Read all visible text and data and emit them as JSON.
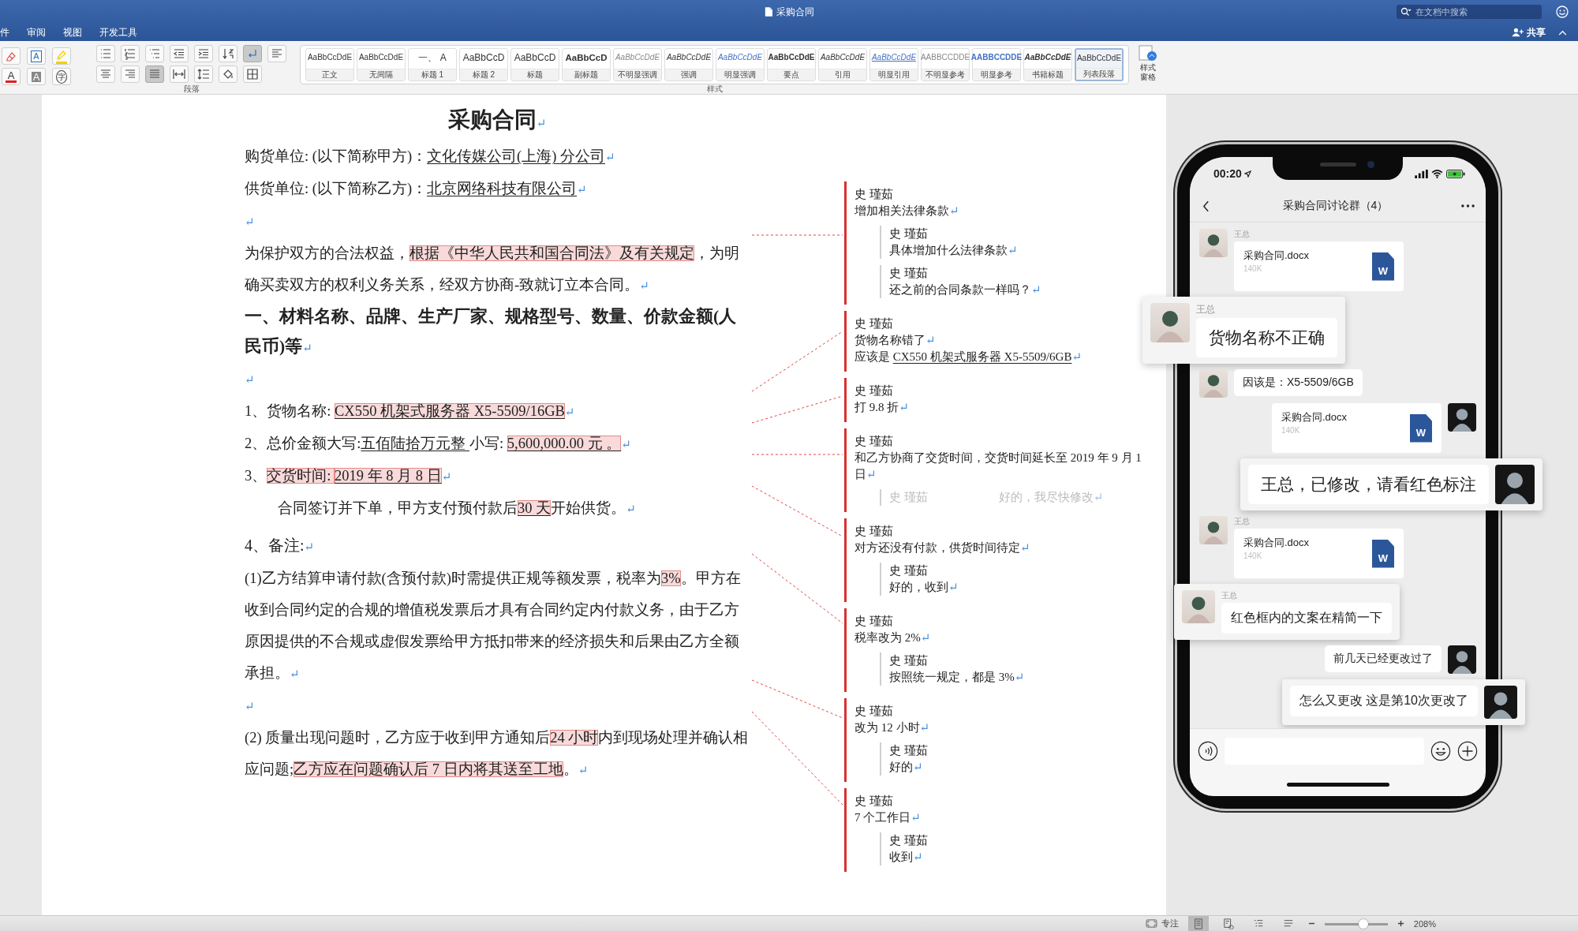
{
  "window": {
    "title": "采购合同",
    "search": {
      "placeholder": "在文档中搜索"
    },
    "share": "共享"
  },
  "ribbon": {
    "tabs": [
      {
        "label": "件"
      },
      {
        "label": "审阅"
      },
      {
        "label": "视图"
      },
      {
        "label": "开发工具"
      }
    ],
    "font_tools": [
      {
        "kind": "clear_format"
      },
      {
        "kind": "text_box",
        "glyph": "A"
      },
      {
        "kind": "highlight"
      },
      {
        "kind": "font_color",
        "glyph": "A"
      },
      {
        "kind": "char_shading",
        "glyph": "A"
      },
      {
        "kind": "enclosed",
        "glyph": "字"
      }
    ],
    "paragraph_tools": [
      {
        "kind": "bullets",
        "on": false
      },
      {
        "kind": "numbering",
        "on": false
      },
      {
        "kind": "multilevel",
        "on": false
      },
      {
        "kind": "outdent",
        "on": false
      },
      {
        "kind": "indent",
        "on": false
      },
      {
        "kind": "sort",
        "on": false
      },
      {
        "kind": "marks",
        "on": true
      },
      {
        "kind": "align_left",
        "on": false
      },
      {
        "kind": "center",
        "on": false
      },
      {
        "kind": "right",
        "on": false
      },
      {
        "kind": "justify",
        "on": true
      },
      {
        "kind": "distribute",
        "on": false
      },
      {
        "kind": "line_spacing",
        "on": false
      },
      {
        "kind": "fill",
        "on": false
      },
      {
        "kind": "borders",
        "on": false
      }
    ],
    "groups": {
      "paragraph": "段落",
      "styles": "样式"
    },
    "styles": [
      {
        "label": "正文",
        "preview": "AaBbCcDdE",
        "kind": "plain",
        "selected": false
      },
      {
        "label": "无间隔",
        "preview": "AaBbCcDdE",
        "kind": "plain",
        "selected": false
      },
      {
        "label": "标题 1",
        "preview": "一、 A",
        "kind": "large",
        "selected": false
      },
      {
        "label": "标题 2",
        "preview": "AaBbCcD",
        "kind": "large",
        "selected": false
      },
      {
        "label": "标题",
        "preview": "AaBbCcD",
        "kind": "large",
        "selected": false
      },
      {
        "label": "副标题",
        "preview": "AaBbCcD",
        "kind": "bold_large",
        "selected": false
      },
      {
        "label": "不明显强调",
        "preview": "AaBbCcDdE",
        "kind": "italic_gray",
        "selected": false
      },
      {
        "label": "强调",
        "preview": "AaBbCcDdE",
        "kind": "italic",
        "selected": false
      },
      {
        "label": "明显强调",
        "preview": "AaBbCcDdE",
        "kind": "blue_italic",
        "selected": false
      },
      {
        "label": "要点",
        "preview": "AaBbCcDdE",
        "kind": "bold",
        "selected": false
      },
      {
        "label": "引用",
        "preview": "AaBbCcDdE",
        "kind": "italic",
        "selected": false
      },
      {
        "label": "明显引用",
        "preview": "AaBbCcDdE",
        "kind": "blue_underline",
        "selected": false
      },
      {
        "label": "不明显参考",
        "preview": "AABBCCDDE",
        "kind": "gray",
        "selected": false
      },
      {
        "label": "明显参考",
        "preview": "AABBCCDDE",
        "kind": "blue_bold",
        "selected": false
      },
      {
        "label": "书籍标题",
        "preview": "AaBbCcDdE",
        "kind": "bold_italic",
        "selected": false
      },
      {
        "label": "列表段落",
        "preview": "AaBbCcDdE",
        "kind": "plain",
        "selected": true
      }
    ],
    "styles_pane": "样式窗格"
  },
  "document": {
    "paragraphs": [
      {
        "kind": "title",
        "segs": [
          {
            "text": "采购合同",
            "kind": "plain"
          },
          {
            "text": "↵",
            "kind": "mark"
          }
        ]
      },
      {
        "kind": "body",
        "segs": [
          {
            "text": "购货单位: (以下简称甲方)：",
            "kind": "plain"
          },
          {
            "text": "文化传媒公司(上海) 分公司",
            "kind": "underline"
          },
          {
            "text": "↵",
            "kind": "mark"
          }
        ]
      },
      {
        "kind": "body",
        "segs": [
          {
            "text": "供货单位: (以下简称乙方)：",
            "kind": "plain"
          },
          {
            "text": "北京网络科技有限公司",
            "kind": "underline"
          },
          {
            "text": "↵",
            "kind": "mark"
          }
        ]
      },
      {
        "kind": "empty",
        "segs": [
          {
            "text": "↵",
            "kind": "mark"
          }
        ]
      },
      {
        "kind": "body",
        "segs": [
          {
            "text": "为保护双方的合法权益，",
            "kind": "plain"
          },
          {
            "text": "根据《中华人民共和国合同法》及有关规定",
            "kind": "tracked"
          },
          {
            "text": "，为明确买卖双方的权利义务关系，经双方协商-致就订立本合同。",
            "kind": "plain"
          },
          {
            "text": "↵",
            "kind": "mark"
          }
        ]
      },
      {
        "kind": "heading",
        "segs": [
          {
            "text": "一、材料名称、品牌、生产厂家、规格型号、数量、价款金额(人民币)等",
            "kind": "plain"
          },
          {
            "text": "↵",
            "kind": "mark"
          }
        ]
      },
      {
        "kind": "empty",
        "segs": [
          {
            "text": "↵",
            "kind": "mark"
          }
        ]
      },
      {
        "kind": "body",
        "segs": [
          {
            "text": "1、货物名称: ",
            "kind": "plain"
          },
          {
            "text": "CX550 机架式服务器 X5-5509/16GB",
            "kind": "tracked_underline"
          },
          {
            "text": "↵",
            "kind": "mark"
          }
        ]
      },
      {
        "kind": "body",
        "segs": [
          {
            "text": "2、总价金额大写:",
            "kind": "plain"
          },
          {
            "text": "五佰陆拾万元整 ",
            "kind": "underline"
          },
          {
            "text": "小写: ",
            "kind": "plain"
          },
          {
            "text": "5,600,000.00 元 。",
            "kind": "tracked_underline"
          },
          {
            "text": "↵",
            "kind": "mark"
          }
        ]
      },
      {
        "kind": "body",
        "segs": [
          {
            "text": "3、",
            "kind": "plain"
          },
          {
            "text": "交货时间: ",
            "kind": "tracked"
          },
          {
            "text": "2019 年 8 月 8 日",
            "kind": "tracked_underline"
          },
          {
            "text": "↵",
            "kind": "mark"
          }
        ]
      },
      {
        "kind": "indent",
        "segs": [
          {
            "text": "合同签订并下单，甲方支付预付款后",
            "kind": "plain"
          },
          {
            "text": "30 天",
            "kind": "tracked_underline"
          },
          {
            "text": "开始供货。",
            "kind": "plain"
          },
          {
            "text": "↵",
            "kind": "mark"
          }
        ]
      },
      {
        "kind": "label",
        "segs": [
          {
            "text": "4、备注:",
            "kind": "plain"
          },
          {
            "text": "↵",
            "kind": "mark"
          }
        ]
      },
      {
        "kind": "body",
        "segs": [
          {
            "text": "(1)乙方结算申请付款(含预付款)时需提供正规等额发票，税率为",
            "kind": "plain"
          },
          {
            "text": "3%",
            "kind": "tracked"
          },
          {
            "text": "。甲方在收到合同约定的合规的增值税发票后才具有合同约定内付款义务，由于乙方原因提供的不合规或虚假发票给甲方抵扣带来的经济损失和后果由乙方全额承担。",
            "kind": "plain"
          },
          {
            "text": "↵",
            "kind": "mark"
          }
        ]
      },
      {
        "kind": "empty",
        "segs": [
          {
            "text": "↵",
            "kind": "mark"
          }
        ]
      },
      {
        "kind": "body",
        "segs": [
          {
            "text": "(2) 质量出现问题时，乙方应于收到甲方通知后",
            "kind": "plain"
          },
          {
            "text": "24 小时",
            "kind": "tracked"
          },
          {
            "text": "内到现场处理并确认相应问题;",
            "kind": "plain"
          },
          {
            "text": "乙方应在问题确认后 7 日内将其送至工地",
            "kind": "tracked"
          },
          {
            "text": "。",
            "kind": "plain"
          },
          {
            "text": "↵",
            "kind": "mark"
          }
        ]
      }
    ]
  },
  "comments": [
    {
      "author": "史 瑾茹",
      "body": [
        [
          {
            "text": "增加相关法律条款",
            "kind": "plain"
          },
          {
            "text": "↵",
            "kind": "mark"
          }
        ]
      ],
      "replies": [
        {
          "author": "史 瑾茹",
          "faded": false,
          "body": [
            [
              {
                "text": "具体增加什么法律条款",
                "kind": "plain"
              },
              {
                "text": "↵",
                "kind": "mark"
              }
            ]
          ]
        },
        {
          "author": "史 瑾茹",
          "faded": false,
          "body": [
            [
              {
                "text": "还之前的合同条款一样吗？",
                "kind": "plain"
              },
              {
                "text": "↵",
                "kind": "mark"
              }
            ]
          ]
        }
      ]
    },
    {
      "author": "史 瑾茹",
      "body": [
        [
          {
            "text": "货物名称错了",
            "kind": "plain"
          },
          {
            "text": "↵",
            "kind": "mark"
          }
        ],
        [
          {
            "text": "应该是 ",
            "kind": "plain"
          },
          {
            "text": "CX550 机架式服务器 X5-5509/6GB",
            "kind": "underline"
          },
          {
            "text": "↵",
            "kind": "mark"
          }
        ]
      ]
    },
    {
      "author": "史 瑾茹",
      "body": [
        [
          {
            "text": "打 9.8 折",
            "kind": "plain"
          },
          {
            "text": "↵",
            "kind": "mark"
          }
        ]
      ]
    },
    {
      "author": "史 瑾茹",
      "body": [
        [
          {
            "text": "和乙方协商了交货时间，交货时间延长至 2019 年 9 月 1 日",
            "kind": "plain"
          },
          {
            "text": "↵",
            "kind": "mark"
          }
        ]
      ],
      "replies": [
        {
          "author": "史 瑾茹",
          "faded": true,
          "body": [
            [
              {
                "text": "好的，我尽快修改",
                "kind": "plain"
              },
              {
                "text": "↵",
                "kind": "mark"
              }
            ]
          ]
        }
      ]
    },
    {
      "author": "史 瑾茹",
      "body": [
        [
          {
            "text": "对方还没有付款，供货时间待定",
            "kind": "plain"
          },
          {
            "text": "↵",
            "kind": "mark"
          }
        ]
      ],
      "replies": [
        {
          "author": "史 瑾茹",
          "faded": false,
          "body": [
            [
              {
                "text": "好的，收到",
                "kind": "plain"
              },
              {
                "text": "↵",
                "kind": "mark"
              }
            ]
          ]
        }
      ]
    },
    {
      "author": "史 瑾茹",
      "body": [
        [
          {
            "text": "税率改为 2%",
            "kind": "plain"
          },
          {
            "text": "↵",
            "kind": "mark"
          }
        ]
      ],
      "replies": [
        {
          "author": "史 瑾茹",
          "faded": false,
          "body": [
            [
              {
                "text": "按照统一规定，都是 3%",
                "kind": "plain"
              },
              {
                "text": "↵",
                "kind": "mark"
              }
            ]
          ]
        }
      ]
    },
    {
      "author": "史 瑾茹",
      "body": [
        [
          {
            "text": "改为 12 小时",
            "kind": "plain"
          },
          {
            "text": "↵",
            "kind": "mark"
          }
        ]
      ],
      "replies": [
        {
          "author": "史 瑾茹",
          "faded": false,
          "body": [
            [
              {
                "text": "好的",
                "kind": "plain"
              },
              {
                "text": "↵",
                "kind": "mark"
              }
            ]
          ]
        }
      ]
    },
    {
      "author": "史 瑾茹",
      "body": [
        [
          {
            "text": "7 个工作日",
            "kind": "plain"
          },
          {
            "text": "↵",
            "kind": "mark"
          }
        ]
      ],
      "replies": [
        {
          "author": "史 瑾茹",
          "faded": false,
          "body": [
            [
              {
                "text": "收到",
                "kind": "plain"
              },
              {
                "text": "↵",
                "kind": "mark"
              }
            ]
          ]
        }
      ]
    }
  ],
  "phone": {
    "time": "00:20",
    "chat_title": "采购合同讨论群（4）",
    "messages": [
      {
        "outgoing": false,
        "kind": "file",
        "sender": "王总",
        "file": {
          "name": "采购合同.docx",
          "size": "140K",
          "icon_letter": "W"
        }
      },
      {
        "outgoing": false,
        "kind": "popup",
        "sender": "王总",
        "text": "货物名称不正确"
      },
      {
        "outgoing": false,
        "kind": "text",
        "text": "因该是：X5-5509/6GB"
      },
      {
        "outgoing": true,
        "kind": "file",
        "file": {
          "name": "采购合同.docx",
          "size": "140K",
          "icon_letter": "W"
        }
      },
      {
        "outgoing": true,
        "kind": "popup",
        "text": "王总，已修改，请看红色标注"
      },
      {
        "outgoing": false,
        "kind": "file",
        "sender": "王总",
        "file": {
          "name": "采购合同.docx",
          "size": "140K",
          "icon_letter": "W"
        }
      },
      {
        "outgoing": false,
        "kind": "popup_small",
        "sender": "王总",
        "text": "红色框内的文案在精简一下"
      },
      {
        "outgoing": true,
        "kind": "text",
        "text": "前几天已经更改过了"
      },
      {
        "outgoing": true,
        "kind": "popup_small",
        "text": "怎么又更改 这是第10次更改了"
      }
    ]
  },
  "status_bar": {
    "focus_label": "专注",
    "views": [
      {
        "kind": "print",
        "selected": true
      },
      {
        "kind": "web",
        "selected": false
      },
      {
        "kind": "outline",
        "selected": false
      },
      {
        "kind": "draft",
        "selected": false
      }
    ],
    "zoom": {
      "level": 0.62
    },
    "zoom_label": "208%"
  }
}
